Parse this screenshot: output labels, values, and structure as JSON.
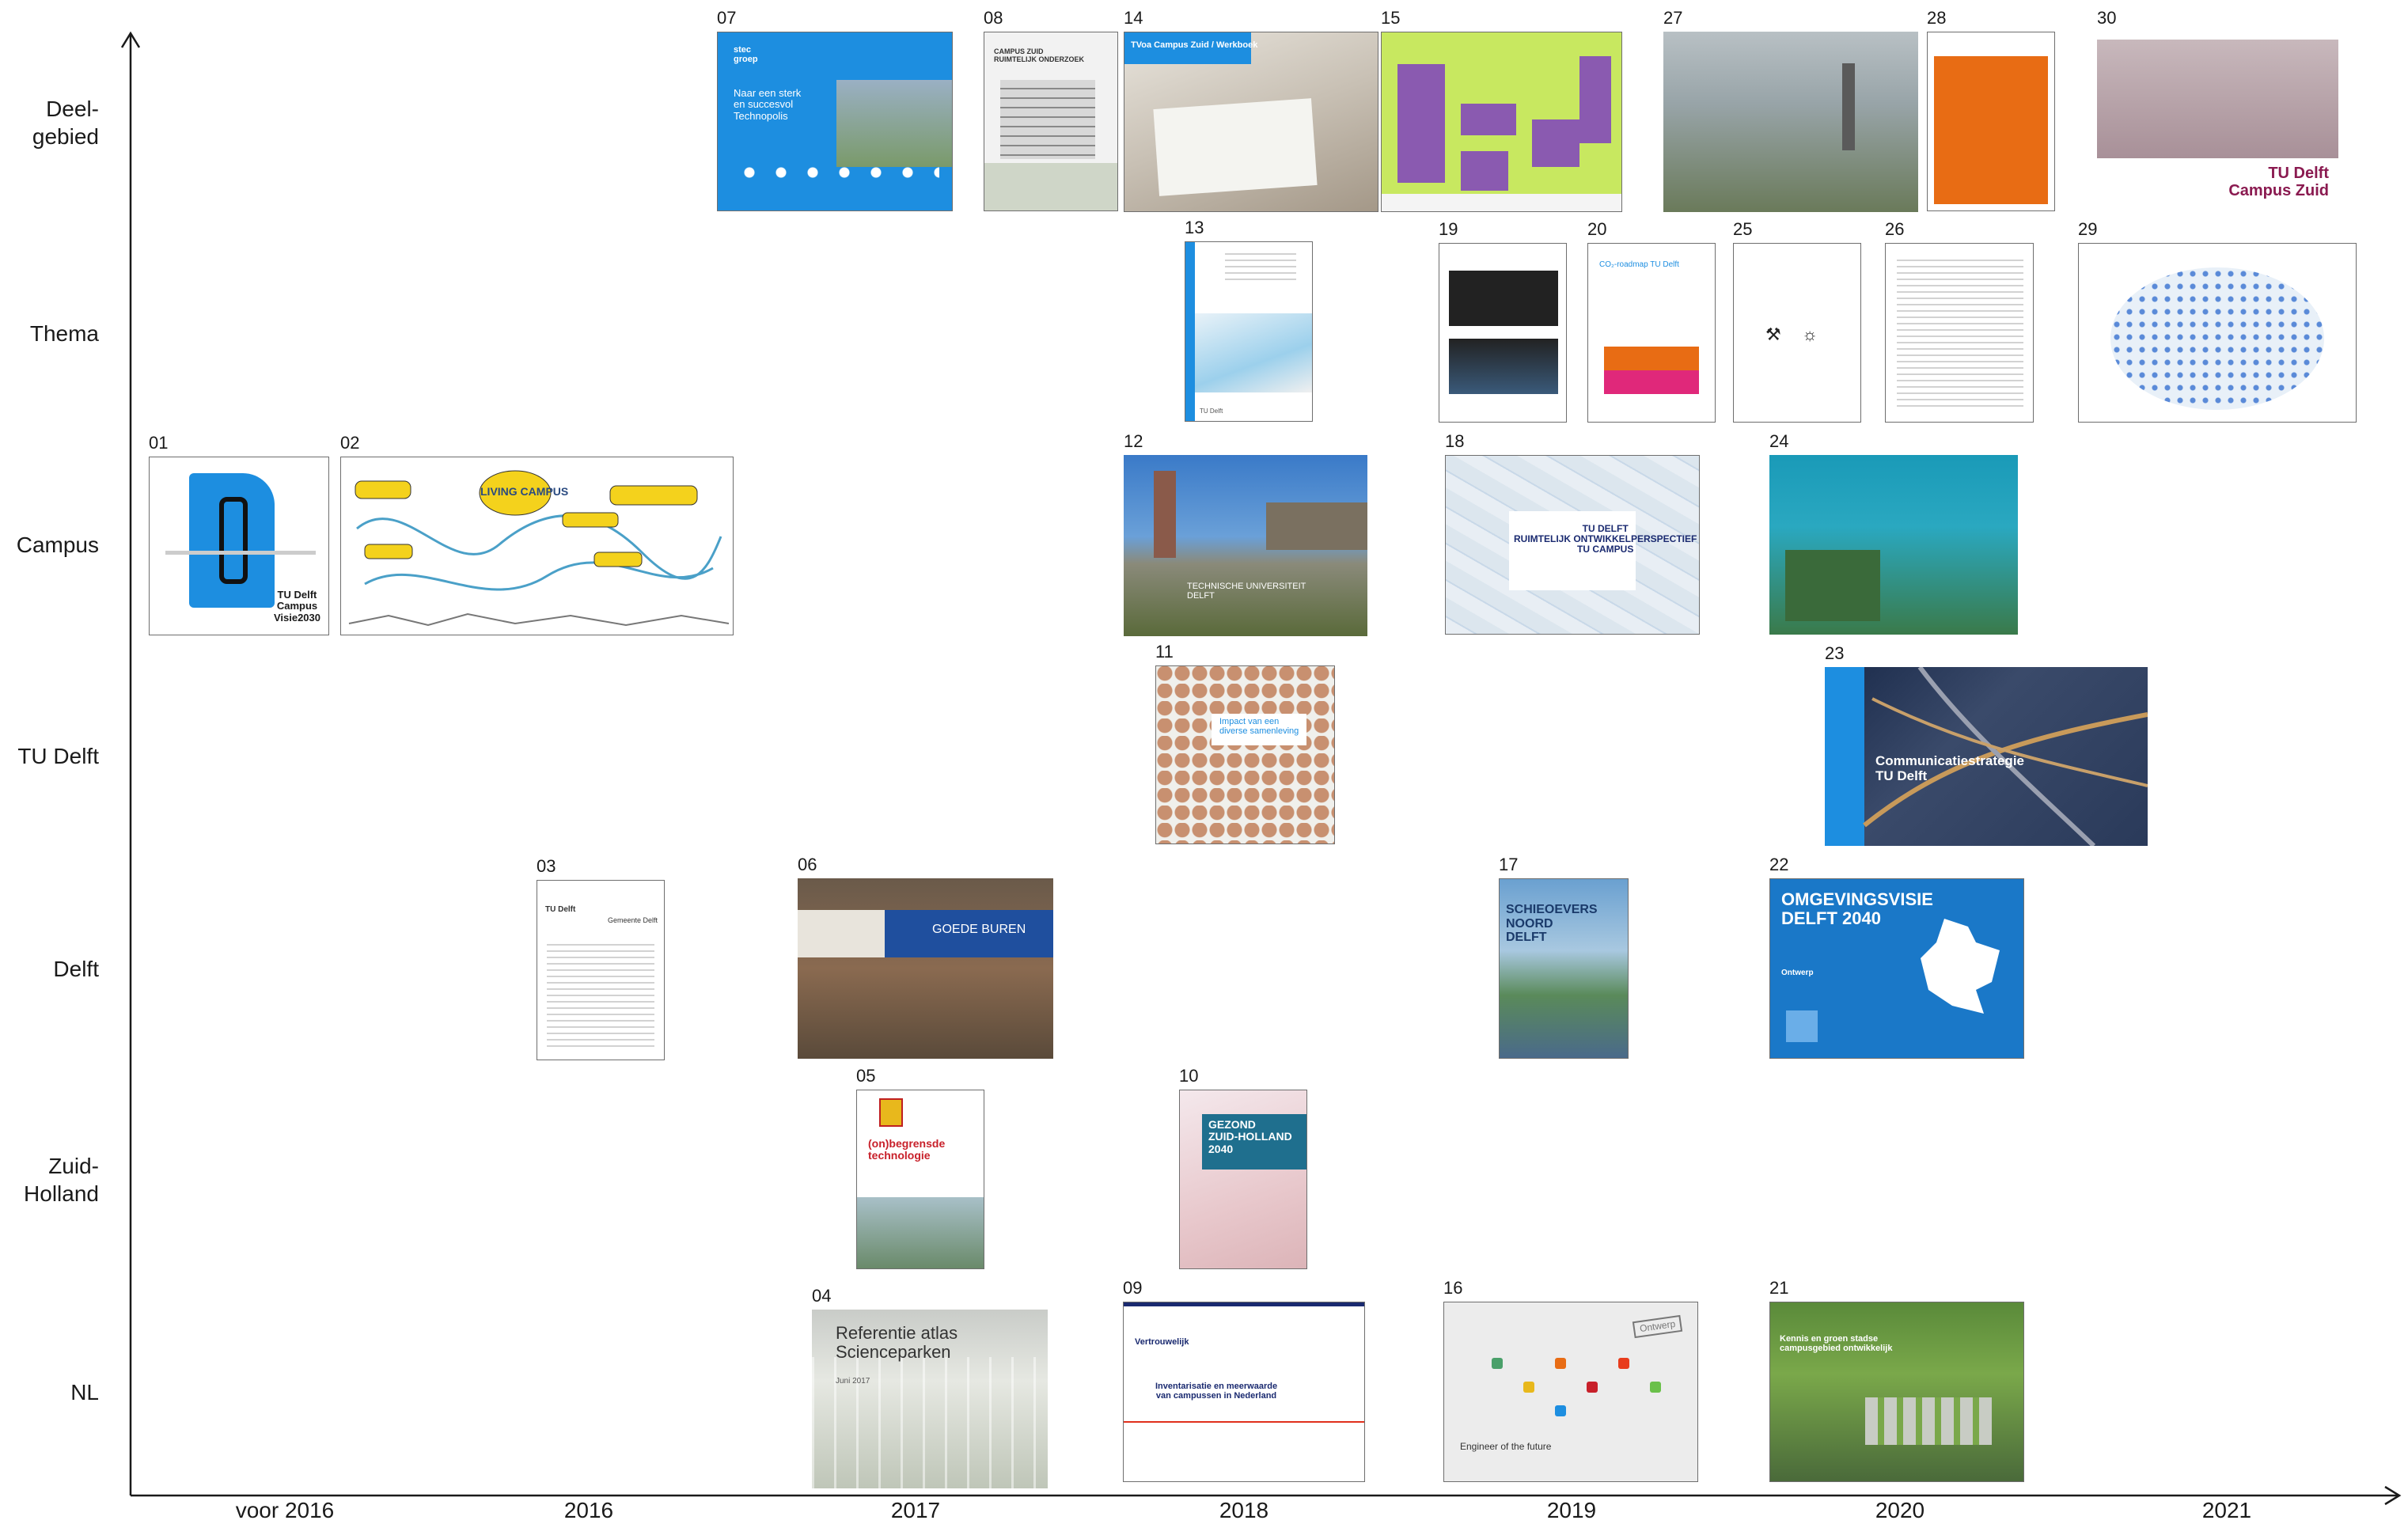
{
  "rows": [
    {
      "id": "deelgebied",
      "label": "Deel-\ngebied"
    },
    {
      "id": "thema",
      "label": "Thema"
    },
    {
      "id": "campus",
      "label": "Campus"
    },
    {
      "id": "tudelft",
      "label": "TU Delft"
    },
    {
      "id": "delft",
      "label": "Delft"
    },
    {
      "id": "zuidholland",
      "label": "Zuid-\nHolland"
    },
    {
      "id": "nl",
      "label": "NL"
    }
  ],
  "columns": [
    "voor 2016",
    "2016",
    "2017",
    "2018",
    "2019",
    "2020",
    "2021"
  ],
  "documents": [
    {
      "num": "01",
      "texts": [
        "TU Delft\nCampus\nVisie2030"
      ]
    },
    {
      "num": "02",
      "texts": [
        "LIVING CAMPUS"
      ]
    },
    {
      "num": "03",
      "texts": [
        "TU Delft",
        "Gemeente Delft"
      ]
    },
    {
      "num": "04",
      "texts": [
        "Referentie atlas\nScienceparken",
        "Juni 2017"
      ]
    },
    {
      "num": "05",
      "texts": [
        "(on)begrensde\ntechnologie"
      ]
    },
    {
      "num": "06",
      "texts": [
        "GOEDE BUREN"
      ]
    },
    {
      "num": "07",
      "texts": [
        "stec\ngroep",
        "Naar een sterk\nen succesvol\nTechnopolis"
      ]
    },
    {
      "num": "08",
      "texts": [
        "CAMPUS ZUID\nRUIMTELIJK ONDERZOEK"
      ]
    },
    {
      "num": "09",
      "texts": [
        "Vertrouwelijk",
        "Inventarisatie en meerwaarde\nvan campussen in Nederland"
      ]
    },
    {
      "num": "10",
      "texts": [
        "GEZOND\nZUID-HOLLAND 2040"
      ]
    },
    {
      "num": "11",
      "texts": [
        "Impact van een\ndiverse samenleving"
      ]
    },
    {
      "num": "12",
      "texts": [
        "TECHNISCHE UNIVERSITEIT\nDELFT"
      ]
    },
    {
      "num": "13",
      "texts": [
        "TU Delft"
      ]
    },
    {
      "num": "14",
      "texts": [
        "TVoa Campus Zuid / Werkboek"
      ]
    },
    {
      "num": "15",
      "texts": []
    },
    {
      "num": "16",
      "texts": [
        "Engineer of the future",
        "Ontwerp"
      ]
    },
    {
      "num": "17",
      "texts": [
        "SCHIEOEVERS\nNOORD\nDELFT"
      ]
    },
    {
      "num": "18",
      "texts": [
        "TU DELFT\nRUIMTELIJK ONTWIKKELPERSPECTIEF\nTU CAMPUS"
      ]
    },
    {
      "num": "19",
      "texts": []
    },
    {
      "num": "20",
      "texts": [
        "CO₂-roadmap TU Delft"
      ]
    },
    {
      "num": "21",
      "texts": [
        "Kennis en groen stadse\ncampusgebied ontwikkelijk"
      ]
    },
    {
      "num": "22",
      "texts": [
        "OMGEVINGSVISIE\nDELFT 2040",
        "Ontwerp"
      ]
    },
    {
      "num": "23",
      "texts": [
        "Communicatiestrategie\nTU Delft"
      ]
    },
    {
      "num": "24",
      "texts": []
    },
    {
      "num": "25",
      "texts": []
    },
    {
      "num": "26",
      "texts": []
    },
    {
      "num": "27",
      "texts": []
    },
    {
      "num": "28",
      "texts": []
    },
    {
      "num": "29",
      "texts": []
    },
    {
      "num": "30",
      "texts": [
        "TU Delft\nCampus Zuid"
      ]
    }
  ],
  "colors": {
    "axis": "#1a1a1a",
    "tu_blue": "#1d8ee0",
    "delft_blue": "#1a6fc0",
    "orange": "#e86c14",
    "purple": "#7d3aa0",
    "green": "#7aa83a",
    "maroon": "#8a1a50"
  }
}
